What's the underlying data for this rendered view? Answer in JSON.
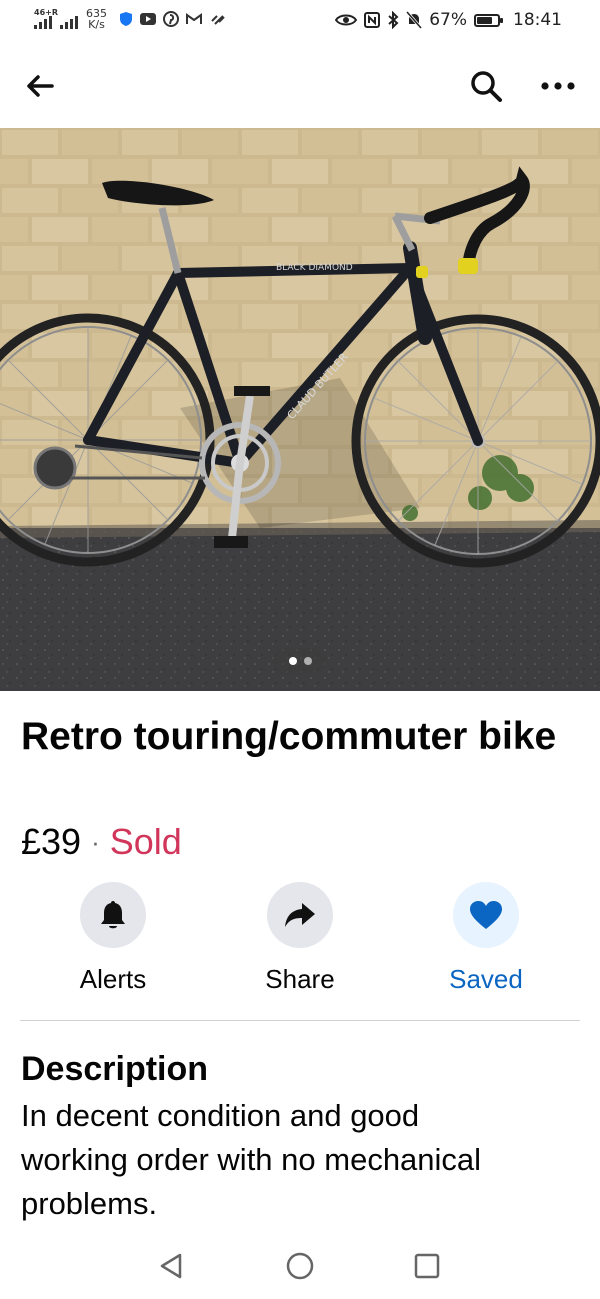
{
  "status_bar": {
    "network_label": "46+R",
    "speed_value": "635",
    "speed_unit": "K/s",
    "battery": "67%",
    "battery_level": 0.67,
    "time": "18:41"
  },
  "appbar": {
    "back_icon": "arrow-left-icon",
    "search_icon": "search-icon",
    "more_icon": "more-horizontal-icon"
  },
  "gallery": {
    "image_count": 2,
    "active_index": 1
  },
  "listing": {
    "title": "Retro touring/commuter bike",
    "price": "£39",
    "separator": "·",
    "status": "Sold"
  },
  "actions": [
    {
      "label": "Alerts",
      "icon": "bell-icon"
    },
    {
      "label": "Share",
      "icon": "share-arrow-icon"
    },
    {
      "label": "Saved",
      "icon": "heart-icon"
    }
  ],
  "description": {
    "heading": "Description",
    "text": "In decent condition and good\nworking order with no mechanical\nproblems."
  },
  "colors": {
    "sold": "#d1365a",
    "saved_blue": "#0a66c2",
    "action_circle": "#e4e6eb"
  }
}
